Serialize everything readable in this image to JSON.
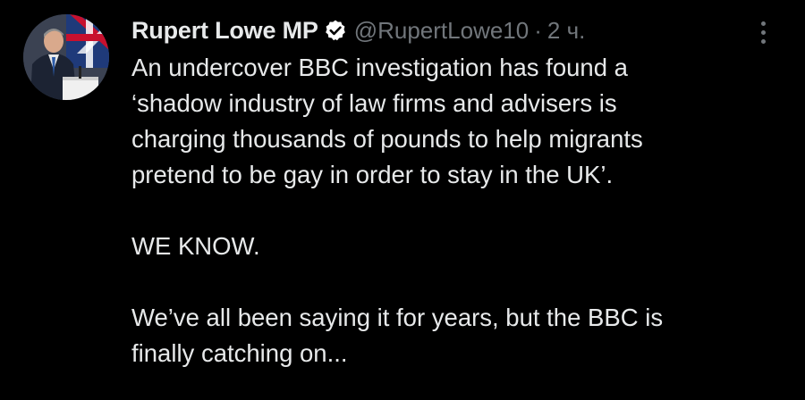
{
  "tweet": {
    "author": {
      "display_name": "Rupert Lowe MP",
      "handle": "@RupertLowe10",
      "verified": true,
      "verified_badge_color": "#ffffff",
      "avatar_icon": "profile-photo"
    },
    "separator": "·",
    "time": "2 ч.",
    "more_icon": "vertical-ellipsis",
    "body": {
      "line_1": "An undercover BBC investigation has found a",
      "line_2": "‘shadow industry of law firms and advisers is",
      "line_3": "charging thousands of pounds to help migrants",
      "line_4": "pretend to be gay in order to stay in the UK’.",
      "line_5": "WE KNOW.",
      "line_6": "We’ve all been saying it for years, but the BBC is",
      "line_7": "finally catching on..."
    }
  },
  "colors": {
    "background": "#000000",
    "primary_text": "#e7e9ea",
    "secondary_text": "#71767b"
  }
}
